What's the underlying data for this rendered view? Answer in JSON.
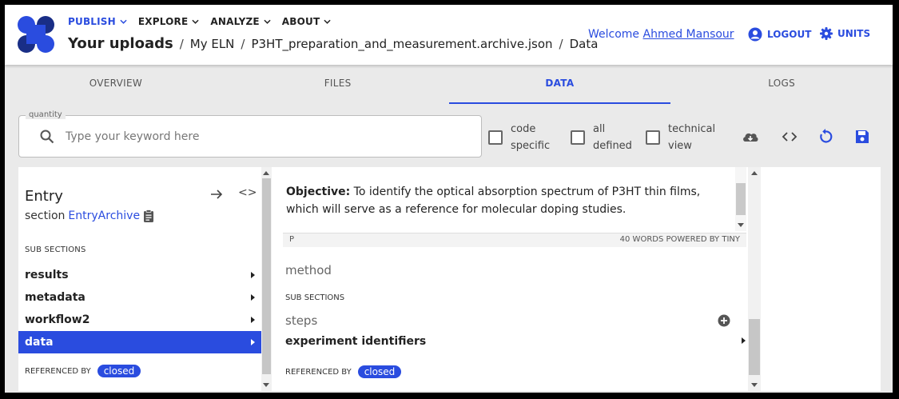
{
  "header": {
    "menu": [
      {
        "label": "PUBLISH",
        "active": true
      },
      {
        "label": "EXPLORE",
        "active": false
      },
      {
        "label": "ANALYZE",
        "active": false
      },
      {
        "label": "ABOUT",
        "active": false
      }
    ],
    "breadcrumb": [
      "Your uploads",
      "My ELN",
      "P3HT_preparation_and_measurement.archive.json",
      "Data"
    ],
    "welcome_prefix": "Welcome",
    "user_name": "Ahmed Mansour",
    "logout_label": "LOGOUT",
    "units_label": "UNITS",
    "accent_color": "#2a4cdf"
  },
  "tabs": [
    {
      "label": "OVERVIEW",
      "active": false
    },
    {
      "label": "FILES",
      "active": false
    },
    {
      "label": "DATA",
      "active": true
    },
    {
      "label": "LOGS",
      "active": false
    }
  ],
  "search": {
    "legend": "quantity",
    "placeholder": "Type your keyword here",
    "value": ""
  },
  "filters": [
    {
      "label": "code specific",
      "checked": false
    },
    {
      "label": "all defined",
      "checked": false
    },
    {
      "label": "technical view",
      "checked": false
    }
  ],
  "toolbar_icons": [
    "cloud-download-icon",
    "code-icon",
    "reload-icon",
    "save-icon"
  ],
  "left_panel": {
    "title": "Entry",
    "section_prefix": "section",
    "section_link": "EntryArchive",
    "code_glyph": "<>",
    "subsections_label": "SUB SECTIONS",
    "items": [
      {
        "label": "results",
        "selected": false
      },
      {
        "label": "metadata",
        "selected": false
      },
      {
        "label": "workflow2",
        "selected": false
      },
      {
        "label": "data",
        "selected": true
      }
    ],
    "referenced_by_label": "REFERENCED BY",
    "referenced_by_chip": "closed"
  },
  "middle_panel": {
    "objective_label": "Objective:",
    "objective_text": " To identify the optical absorption spectrum of P3HT thin films, which will serve as a reference for molecular doping studies.",
    "editor_status_left": "P",
    "editor_status_right": "40 WORDS  POWERED BY TINY",
    "method_label": "method",
    "subsections_label": "SUB SECTIONS",
    "steps_label": "steps",
    "experiment_identifiers_label": "experiment identifiers",
    "referenced_by_label": "REFERENCED BY",
    "referenced_by_chip": "closed"
  }
}
